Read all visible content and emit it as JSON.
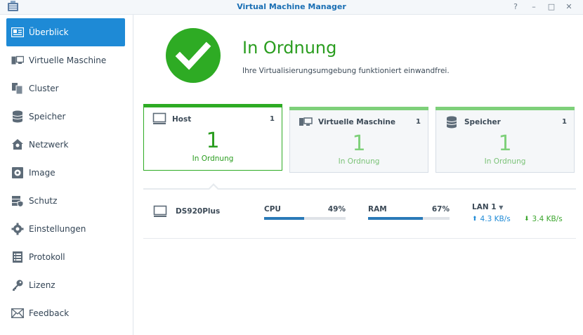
{
  "window": {
    "title": "Virtual Machine Manager",
    "help_icon": "?",
    "minimize_icon": "–",
    "maximize_icon": "□",
    "close_icon": "✕"
  },
  "sidebar": {
    "items": [
      {
        "label": "Überblick",
        "icon": "overview-icon",
        "active": true
      },
      {
        "label": "Virtuelle Maschine",
        "icon": "virtual-machine-icon"
      },
      {
        "label": "Cluster",
        "icon": "cluster-icon"
      },
      {
        "label": "Speicher",
        "icon": "storage-icon"
      },
      {
        "label": "Netzwerk",
        "icon": "network-icon"
      },
      {
        "label": "Image",
        "icon": "image-icon"
      },
      {
        "label": "Schutz",
        "icon": "protection-icon"
      },
      {
        "label": "Einstellungen",
        "icon": "settings-gear-icon"
      },
      {
        "label": "Protokoll",
        "icon": "log-icon"
      },
      {
        "label": "Lizenz",
        "icon": "key-icon"
      },
      {
        "label": "Feedback",
        "icon": "envelope-icon"
      }
    ]
  },
  "status": {
    "title": "In Ordnung",
    "description": "Ihre Virtualisierungsumgebung funktioniert einwandfrei.",
    "color": "#2eab24"
  },
  "cards": [
    {
      "title": "Host",
      "count": "1",
      "value": "1",
      "status": "In Ordnung",
      "icon": "monitor-icon",
      "active": true
    },
    {
      "title": "Virtuelle Maschine",
      "count": "1",
      "value": "1",
      "status": "In Ordnung",
      "icon": "virtual-machine-icon"
    },
    {
      "title": "Speicher",
      "count": "1",
      "value": "1",
      "status": "In Ordnung",
      "icon": "database-icon"
    }
  ],
  "host_row": {
    "name": "DS920Plus",
    "cpu": {
      "label": "CPU",
      "value": "49%",
      "fraction": 0.49
    },
    "ram": {
      "label": "RAM",
      "value": "67%",
      "fraction": 0.67
    },
    "lan": {
      "label": "LAN 1",
      "upload": "4.3 KB/s",
      "download": "3.4 KB/s"
    }
  },
  "colors": {
    "accent": "#1e8ad6",
    "ok_green": "#2eab24",
    "bar_fill": "#2a7ab8",
    "upload": "#1e8ad6",
    "download": "#3aa52c"
  }
}
